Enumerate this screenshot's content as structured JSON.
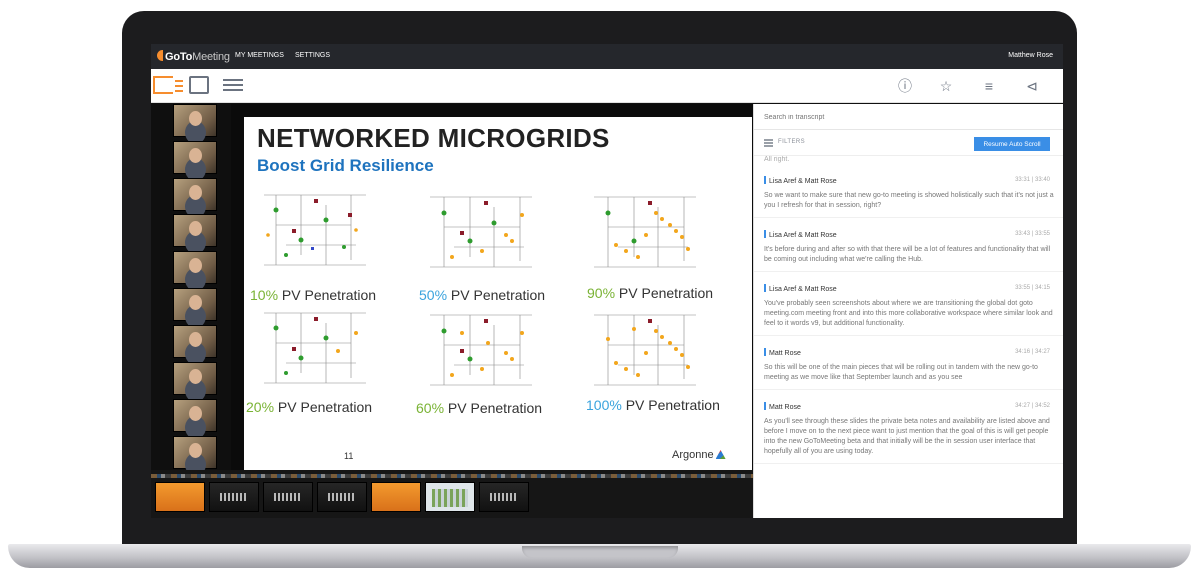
{
  "app": {
    "logo_bold": "GoTo",
    "logo_light": "Meeting",
    "nav_my_meetings": "MY MEETINGS",
    "nav_settings": "SETTINGS",
    "user_name": "Matthew Rose"
  },
  "toolbar": {
    "icons": [
      "layout-sidebar-icon",
      "layout-single-icon",
      "layout-list-icon",
      "info-icon",
      "star-icon",
      "notes-icon",
      "share-icon"
    ],
    "accent": "#f68d2e"
  },
  "slide": {
    "title": "NETWORKED MICROGRIDS",
    "subtitle": "Boost Grid Resilience",
    "panels": [
      {
        "pct": "10%",
        "label": "PV Penetration",
        "pct_color": "green"
      },
      {
        "pct": "50%",
        "label": "PV Penetration",
        "pct_color": "blue"
      },
      {
        "pct": "90%",
        "label": "PV Penetration",
        "pct_color": "green"
      },
      {
        "pct": "20%",
        "label": "PV Penetration",
        "pct_color": "green"
      },
      {
        "pct": "60%",
        "label": "PV Penetration",
        "pct_color": "green"
      },
      {
        "pct": "100%",
        "label": "PV Penetration",
        "pct_color": "blue"
      }
    ],
    "page_number": "11",
    "footer_brand": "Argonne"
  },
  "transcript": {
    "search_placeholder": "Search in transcript",
    "filters_label": "FILTERS",
    "resume_label": "Resume Auto Scroll",
    "cut_text": "All right.",
    "entries": [
      {
        "speaker": "Lisa Aref & Matt Rose",
        "time": "33:31 | 33:40",
        "text": "So we want to make sure that new go-to meeting is showed holistically such that it's not just a you I refresh for that in session, right?"
      },
      {
        "speaker": "Lisa Aref & Matt Rose",
        "time": "33:43 | 33:55",
        "text": "It's before during and after so with that there will be a lot of features and functionality that will be coming out including what we're calling the Hub."
      },
      {
        "speaker": "Lisa Aref & Matt Rose",
        "time": "33:55 | 34:15",
        "text": "You've probably seen screenshots about where we are transitioning the global dot goto meeting.com meeting front and into this more collaborative workspace where similar look and feel to it words v9, but additional functionality."
      },
      {
        "speaker": "Matt Rose",
        "time": "34:16 | 34:27",
        "text": "So this will be one of the main pieces that will be rolling out in tandem with the new go-to meeting as we move like that September launch and as you see"
      },
      {
        "speaker": "Matt Rose",
        "time": "34:27 | 34:52",
        "text": "As you'll see through these slides the private beta notes and availability are listed above and before I move on to the next piece want to just mention that the goal of this is will get people into the new GoToMeeting beta and that initially will be the in session user interface that hopefully all of you are using today."
      }
    ]
  }
}
